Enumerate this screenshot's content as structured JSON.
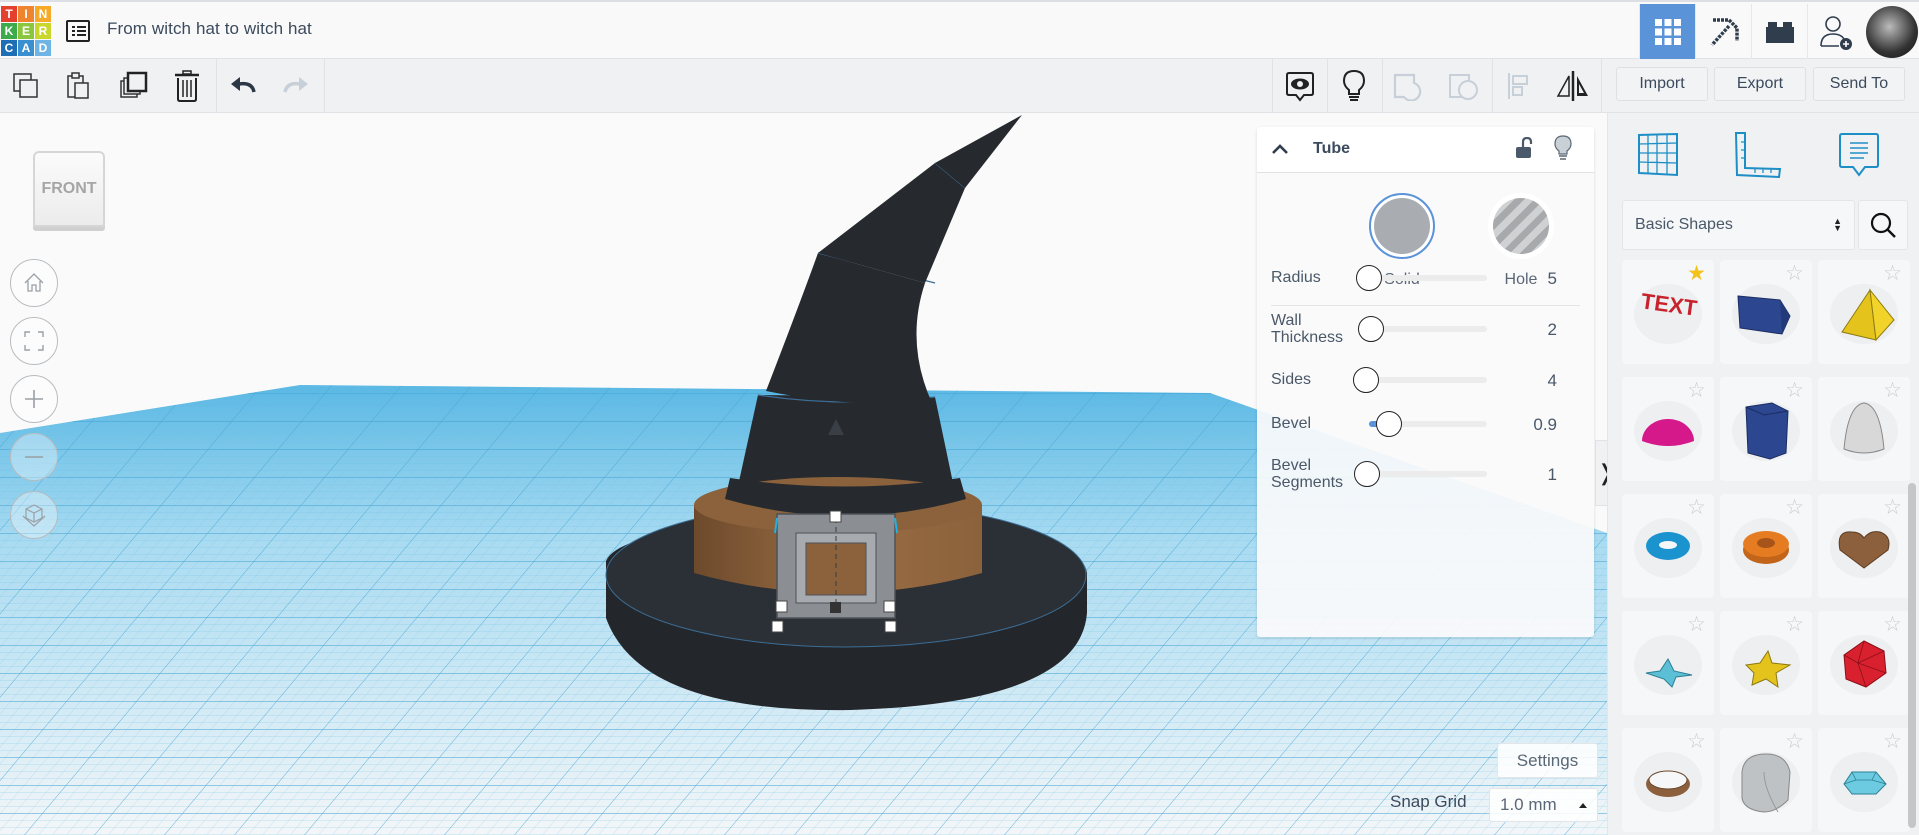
{
  "app": {
    "logo_letters": [
      "T",
      "I",
      "N",
      "K",
      "E",
      "R",
      "C",
      "A",
      "D"
    ],
    "logo_colors": [
      "#e5402e",
      "#f0842d",
      "#f7a928",
      "#3dab4b",
      "#8cc63e",
      "#c9d72b",
      "#1e6eb5",
      "#3a8fd1",
      "#6eb5e5"
    ],
    "title": "From witch hat to witch hat",
    "accent": "#5b93d9"
  },
  "header": {
    "buttons": [
      {
        "name": "3d-design-view",
        "icon": "grid-icon",
        "active": true
      },
      {
        "name": "blocks-view",
        "icon": "pickaxe-icon",
        "active": false
      },
      {
        "name": "bricks-view",
        "icon": "brick-icon",
        "active": false
      },
      {
        "name": "invite-user",
        "icon": "add-user-icon",
        "active": false
      }
    ],
    "avatar": "user-avatar"
  },
  "toolbar": {
    "left": [
      {
        "name": "copy",
        "icon": "copy-icon",
        "enabled": true
      },
      {
        "name": "paste",
        "icon": "paste-icon",
        "enabled": true
      },
      {
        "name": "duplicate",
        "icon": "duplicate-icon",
        "enabled": true
      },
      {
        "name": "delete",
        "icon": "trash-icon",
        "enabled": true
      },
      {
        "name": "undo",
        "icon": "undo-icon",
        "enabled": true
      },
      {
        "name": "redo",
        "icon": "redo-icon",
        "enabled": false
      }
    ],
    "right": [
      {
        "name": "notes",
        "icon": "eye-note-icon",
        "enabled": true
      },
      {
        "name": "show-all",
        "icon": "lightbulb-icon",
        "enabled": true
      },
      {
        "name": "group",
        "icon": "group-icon",
        "enabled": false
      },
      {
        "name": "ungroup",
        "icon": "ungroup-icon",
        "enabled": false
      },
      {
        "name": "align",
        "icon": "align-icon",
        "enabled": false
      },
      {
        "name": "mirror",
        "icon": "mirror-icon",
        "enabled": true
      }
    ],
    "import_label": "Import",
    "export_label": "Export",
    "send_to_label": "Send To"
  },
  "viewport": {
    "viewcube_label": "FRONT",
    "nav": [
      {
        "name": "home-view",
        "icon": "home-icon"
      },
      {
        "name": "fit-all",
        "icon": "fit-icon"
      },
      {
        "name": "zoom-in",
        "icon": "plus-icon"
      },
      {
        "name": "zoom-out",
        "icon": "minus-icon"
      },
      {
        "name": "ortho-perspective",
        "icon": "cube-icon"
      }
    ],
    "settings_label": "Settings",
    "snap_grid_label": "Snap Grid",
    "snap_grid_value": "1.0 mm"
  },
  "inspector": {
    "shape_name": "Tube",
    "modes": [
      {
        "label": "Solid",
        "selected": true
      },
      {
        "label": "Hole",
        "selected": false
      }
    ],
    "properties": [
      {
        "label": "Radius",
        "value": "5",
        "fraction": 0.0
      },
      {
        "label": "Wall Thickness",
        "value": "2",
        "fraction": 0.0
      },
      {
        "label": "Sides",
        "value": "4",
        "fraction": 0.0
      },
      {
        "label": "Bevel",
        "value": "0.9",
        "fraction": 0.17
      },
      {
        "label": "Bevel Segments",
        "value": "1",
        "fraction": 0.0
      }
    ]
  },
  "library": {
    "selected": "Basic Shapes",
    "tools": [
      {
        "name": "workplane",
        "icon": "workplane-icon"
      },
      {
        "name": "ruler",
        "icon": "ruler-icon"
      },
      {
        "name": "notes",
        "icon": "note-icon"
      }
    ],
    "shapes": [
      {
        "name": "Text",
        "favorite": true,
        "color": "#c8232c"
      },
      {
        "name": "Box",
        "favorite": false,
        "color": "#2c4690"
      },
      {
        "name": "Pyramid",
        "favorite": false,
        "color": "#e4c31c"
      },
      {
        "name": "Half Sphere",
        "favorite": false,
        "color": "#d5188a"
      },
      {
        "name": "Polygon",
        "favorite": false,
        "color": "#2c4690"
      },
      {
        "name": "Paraboloid",
        "favorite": false,
        "color": "#d8d8d8"
      },
      {
        "name": "Torus",
        "favorite": false,
        "color": "#1a93cf"
      },
      {
        "name": "Tube",
        "favorite": false,
        "color": "#e67c22"
      },
      {
        "name": "Heart",
        "favorite": false,
        "color": "#8c5f3d"
      },
      {
        "name": "Star",
        "favorite": false,
        "color": "#5bbfd6"
      },
      {
        "name": "Star Extruded",
        "favorite": false,
        "color": "#e4c31c"
      },
      {
        "name": "Icosahedron",
        "favorite": false,
        "color": "#d9202f"
      },
      {
        "name": "Ring",
        "favorite": false,
        "color": "#8c5f3d"
      },
      {
        "name": "Round Roof",
        "favorite": false,
        "color": "#bfc2c5"
      },
      {
        "name": "Diamond",
        "favorite": false,
        "color": "#6ccbe0"
      }
    ]
  }
}
